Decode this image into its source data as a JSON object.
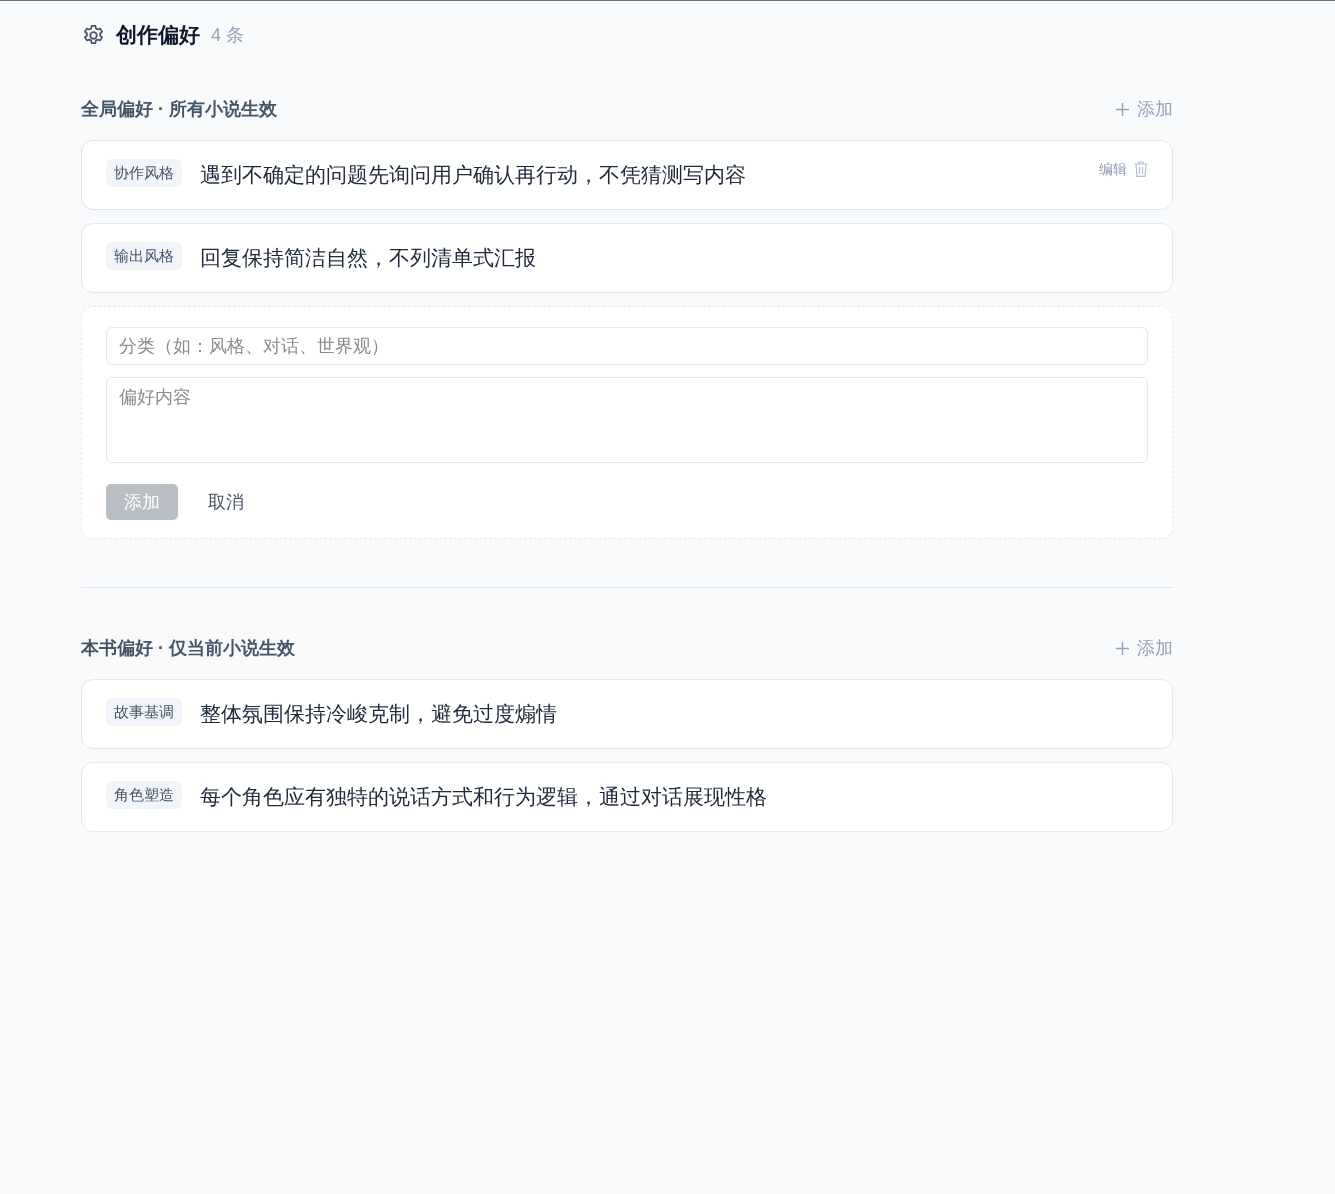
{
  "header": {
    "title": "创作偏好",
    "count": "4 条"
  },
  "sections": [
    {
      "title": "全局偏好 · 所有小说生效",
      "add_label": "添加",
      "items": [
        {
          "category": "协作风格",
          "content": "遇到不确定的问题先询问用户确认再行动，不凭猜测写内容",
          "hovered": true,
          "edit_label": "编辑"
        },
        {
          "category": "输出风格",
          "content": "回复保持简洁自然，不列清单式汇报",
          "hovered": false
        }
      ],
      "form": {
        "category_placeholder": "分类（如：风格、对话、世界观）",
        "content_placeholder": "偏好内容",
        "submit_label": "添加",
        "submit_disabled": true,
        "cancel_label": "取消"
      }
    },
    {
      "title": "本书偏好 · 仅当前小说生效",
      "add_label": "添加",
      "items": [
        {
          "category": "故事基调",
          "content": "整体氛围保持冷峻克制，避免过度煽情",
          "hovered": false
        },
        {
          "category": "角色塑造",
          "content": "每个角色应有独特的说话方式和行为逻辑，通过对话展现性格",
          "hovered": false
        }
      ]
    }
  ]
}
